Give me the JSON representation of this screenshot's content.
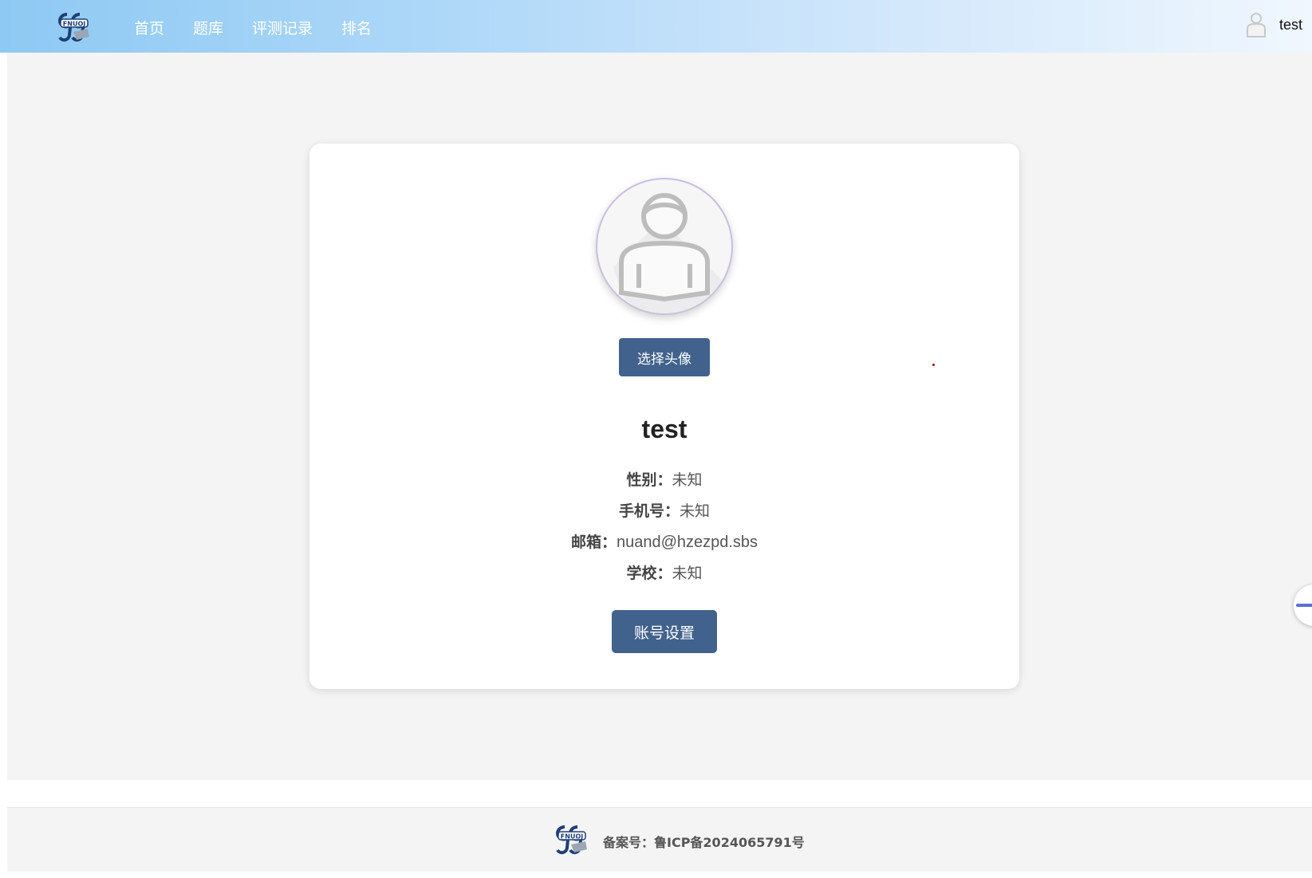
{
  "header": {
    "logo_text": "FNUOJ",
    "nav": [
      {
        "label": "首页"
      },
      {
        "label": "题库"
      },
      {
        "label": "评测记录"
      },
      {
        "label": "排名"
      }
    ],
    "user": {
      "name": "test",
      "avatar_icon": "user-avatar-icon"
    }
  },
  "profile": {
    "avatar_icon": "default-user-avatar-icon",
    "choose_avatar_label": "选择头像",
    "username": "test",
    "gender": {
      "label": "性别：",
      "value": "未知"
    },
    "phone": {
      "label": "手机号：",
      "value": "未知"
    },
    "email": {
      "label": "邮箱：",
      "value": "nuand@hzezpd.sbs"
    },
    "school": {
      "label": "学校：",
      "value": "未知"
    },
    "settings_label": "账号设置"
  },
  "footer": {
    "logo_text": "FNUOJ",
    "icp": "备案号：鲁ICP备2024065791号"
  },
  "colors": {
    "primary_button": "#41628c",
    "header_gradient_start": "#8ec9f3",
    "header_gradient_end": "#f0f7fe",
    "page_background": "#f4f4f4"
  }
}
